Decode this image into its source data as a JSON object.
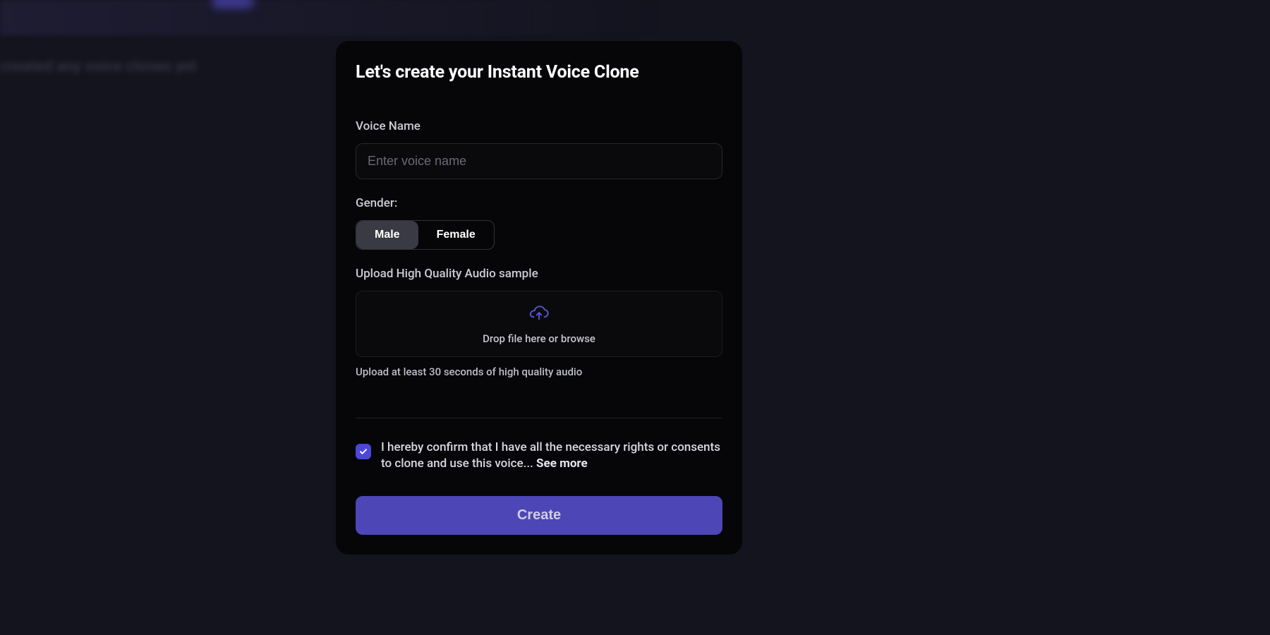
{
  "background": {
    "ghost_text": "created any voice clones yet"
  },
  "modal": {
    "title": "Let's create your Instant Voice Clone",
    "voice_name": {
      "label": "Voice Name",
      "placeholder": "Enter voice name",
      "value": ""
    },
    "gender": {
      "label": "Gender:",
      "options": [
        "Male",
        "Female"
      ],
      "selected": "Male"
    },
    "upload": {
      "label": "Upload High Quality Audio sample",
      "dropzone_text": "Drop file here or browse",
      "hint": "Upload at least 30 seconds of high quality audio"
    },
    "consent": {
      "checked": true,
      "text": "I hereby confirm that I have all the necessary rights or consents to clone and use this voice...",
      "see_more": "See more"
    },
    "create_label": "Create"
  },
  "colors": {
    "accent": "#4d46d8",
    "modal_bg": "#060608",
    "page_bg": "#14141f"
  }
}
